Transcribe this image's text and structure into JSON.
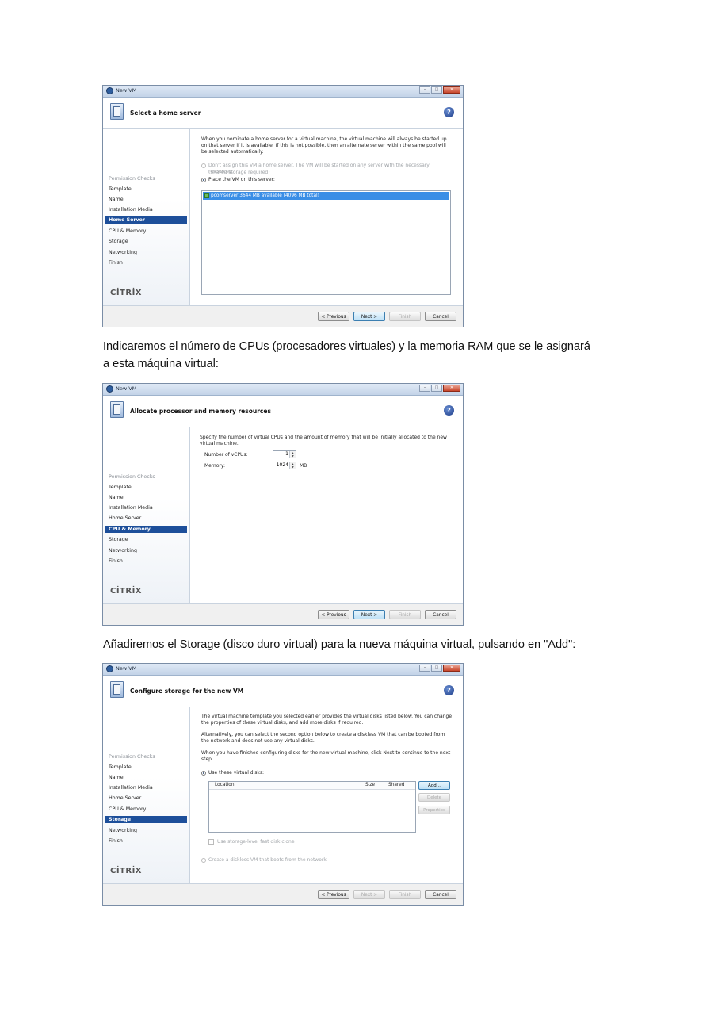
{
  "text": {
    "p1_line1": "Indicaremos el número de CPUs (procesadores virtuales) y la memoria RAM que se le asignará",
    "p1_line2": "a esta máquina virtual:",
    "p2": "Añadiremos el Storage (disco duro virtual) para la nueva máquina virtual, pulsando en \"Add\":"
  },
  "window": {
    "title": "New VM",
    "help_glyph": "?",
    "logo": "CİTRİX",
    "sidebar": [
      "Permission Checks",
      "Template",
      "Name",
      "Installation Media",
      "Home Server",
      "CPU & Memory",
      "Storage",
      "Networking",
      "Finish"
    ],
    "buttons": {
      "previous": "< Previous",
      "next": "Next >",
      "finish": "Finish",
      "cancel": "Cancel"
    }
  },
  "dialog1": {
    "heading": "Select a home server",
    "intro": "When you nominate a home server for a virtual machine, the virtual machine will always be started up on that server if it is available. If this is not possible, then an alternate server within the same pool will be selected automatically.",
    "option_no_home_l1": "Don't assign this VM a home server. The VM will be started on any server with the necessary resources.",
    "option_no_home_l2": "(Shared storage required)",
    "option_place": "Place the VM on this server:",
    "server_row": "pcomserver  3644 MB available (4096 MB total)"
  },
  "dialog2": {
    "heading": "Allocate processor and memory resources",
    "intro": "Specify the number of virtual CPUs and the amount of memory that will be initially allocated to the new virtual machine.",
    "vcpus_label": "Number of vCPUs:",
    "vcpus_value": "1",
    "memory_label": "Memory:",
    "memory_value": "1024",
    "memory_unit": "MB"
  },
  "dialog3": {
    "heading": "Configure storage for the new VM",
    "para1": "The virtual machine template you selected earlier provides the virtual disks listed below. You can change the properties of these virtual disks, and add more disks if required.",
    "para2": "Alternatively, you can select the second option below to create a diskless VM that can be booted from the network and does not use any virtual disks.",
    "para3": "When you have finished configuring disks for the new virtual machine, click Next to continue to the next step.",
    "option_use_disks": "Use these virtual disks:",
    "columns": [
      "Location",
      "Size",
      "Shared"
    ],
    "add_button": "Add...",
    "delete_button": "Delete",
    "properties_button": "Properties",
    "fast_clone": "Use storage-level fast disk clone",
    "option_diskless": "Create a diskless VM that boots from the network"
  }
}
